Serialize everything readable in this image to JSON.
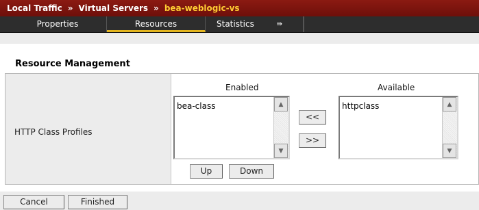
{
  "breadcrumb": {
    "items": [
      "Local Traffic",
      "Virtual Servers",
      "bea-weblogic-vs"
    ],
    "separator": "»",
    "current_color": "#ffcc33"
  },
  "tabs": [
    {
      "label": "Properties",
      "active": false
    },
    {
      "label": "Resources",
      "active": true
    },
    {
      "label": "Statistics",
      "active": false,
      "icon": "arrow-right-icon",
      "icon_glyph": "⇛"
    }
  ],
  "section": {
    "title": "Resource Management"
  },
  "profiles": {
    "row_label": "HTTP Class Profiles",
    "enabled_header": "Enabled",
    "available_header": "Available",
    "enabled_items": [
      "bea-class"
    ],
    "available_items": [
      "httpclass"
    ],
    "move_left_label": "<<",
    "move_right_label": ">>",
    "up_label": "Up",
    "down_label": "Down"
  },
  "footer": {
    "cancel_label": "Cancel",
    "finished_label": "Finished"
  },
  "colors": {
    "titlebar": "#7a140d",
    "tab_active_underline": "#e3b51f",
    "tab_bar": "#2d2d2d"
  }
}
